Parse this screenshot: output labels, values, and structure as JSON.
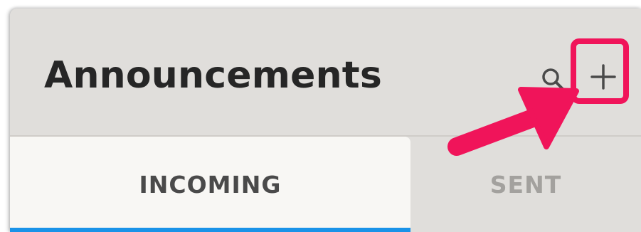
{
  "header": {
    "title": "Announcements",
    "actions": [
      {
        "name": "search",
        "icon": "search-icon"
      },
      {
        "name": "add",
        "icon": "plus-icon"
      }
    ]
  },
  "tabs": [
    {
      "label": "INCOMING",
      "selected": true
    },
    {
      "label": "SENT",
      "selected": false
    }
  ],
  "colors": {
    "header_bg": "#e0dedb",
    "active_tab_bg": "#f8f7f4",
    "tab_indicator": "#1a93e8",
    "annotation_highlight": "#f0145a"
  }
}
